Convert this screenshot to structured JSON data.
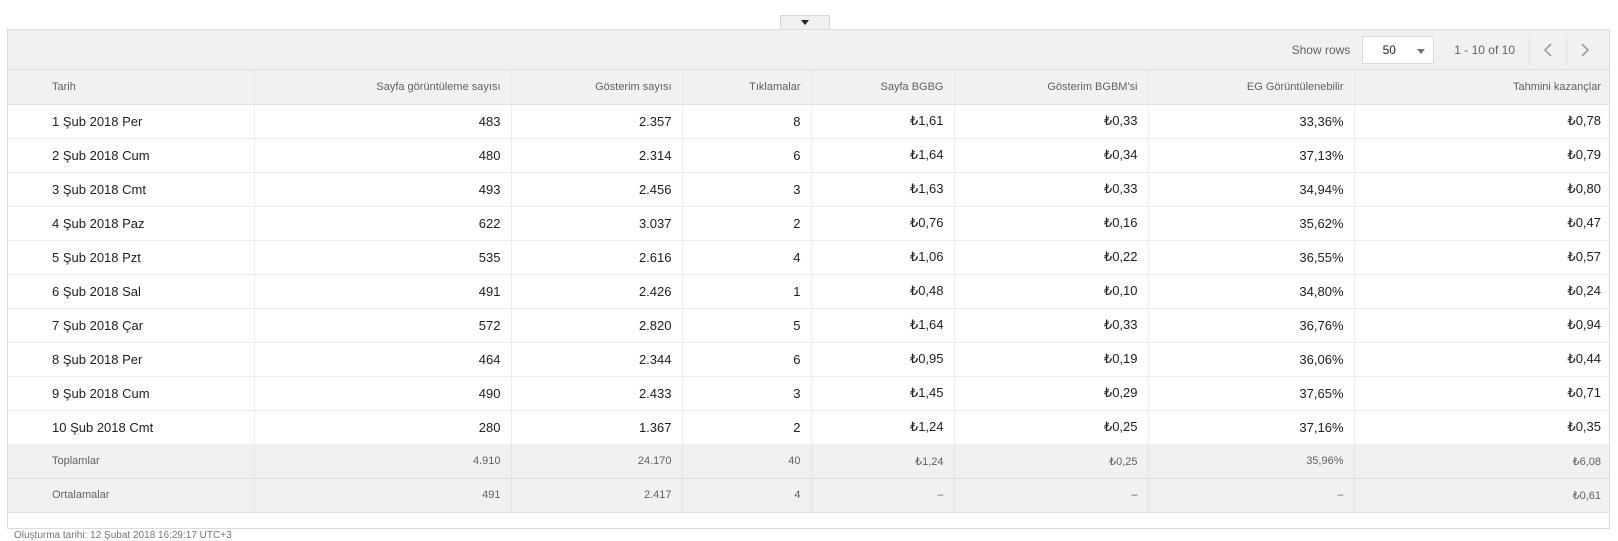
{
  "toolbar": {
    "show_rows_label": "Show rows",
    "rows_per_page": "50",
    "range_text": "1 - 10 of 10",
    "prev_icon": "chevron-left-icon",
    "next_icon": "chevron-right-icon"
  },
  "table": {
    "columns": [
      "Tarih",
      "Sayfa görüntüleme sayısı",
      "Gösterim sayısı",
      "Tıklamalar",
      "Sayfa BGBG",
      "Gösterim BGBM'si",
      "EG Görüntülenebilir",
      "Tahmini kazançlar"
    ],
    "rows": [
      [
        "1 Şub 2018 Per",
        "483",
        "2.357",
        "8",
        "₺1,61",
        "₺0,33",
        "33,36%",
        "₺0,78"
      ],
      [
        "2 Şub 2018 Cum",
        "480",
        "2.314",
        "6",
        "₺1,64",
        "₺0,34",
        "37,13%",
        "₺0,79"
      ],
      [
        "3 Şub 2018 Cmt",
        "493",
        "2.456",
        "3",
        "₺1,63",
        "₺0,33",
        "34,94%",
        "₺0,80"
      ],
      [
        "4 Şub 2018 Paz",
        "622",
        "3.037",
        "2",
        "₺0,76",
        "₺0,16",
        "35,62%",
        "₺0,47"
      ],
      [
        "5 Şub 2018 Pzt",
        "535",
        "2.616",
        "4",
        "₺1,06",
        "₺0,22",
        "36,55%",
        "₺0,57"
      ],
      [
        "6 Şub 2018 Sal",
        "491",
        "2.426",
        "1",
        "₺0,48",
        "₺0,10",
        "34,80%",
        "₺0,24"
      ],
      [
        "7 Şub 2018 Çar",
        "572",
        "2.820",
        "5",
        "₺1,64",
        "₺0,33",
        "36,76%",
        "₺0,94"
      ],
      [
        "8 Şub 2018 Per",
        "464",
        "2.344",
        "6",
        "₺0,95",
        "₺0,19",
        "36,06%",
        "₺0,44"
      ],
      [
        "9 Şub 2018 Cum",
        "490",
        "2.433",
        "3",
        "₺1,45",
        "₺0,29",
        "37,65%",
        "₺0,71"
      ],
      [
        "10 Şub 2018 Cmt",
        "280",
        "1.367",
        "2",
        "₺1,24",
        "₺0,25",
        "37,16%",
        "₺0,35"
      ]
    ],
    "totals": [
      "Toplamlar",
      "4.910",
      "24.170",
      "40",
      "₺1,24",
      "₺0,25",
      "35,96%",
      "₺6,08"
    ],
    "averages": [
      "Ortalamalar",
      "491",
      "2.417",
      "4",
      "–",
      "–",
      "–",
      "₺0,61"
    ]
  },
  "footnote": "Oluşturma tarihi: 12 Şubat 2018 16:29:17 UTC+3"
}
